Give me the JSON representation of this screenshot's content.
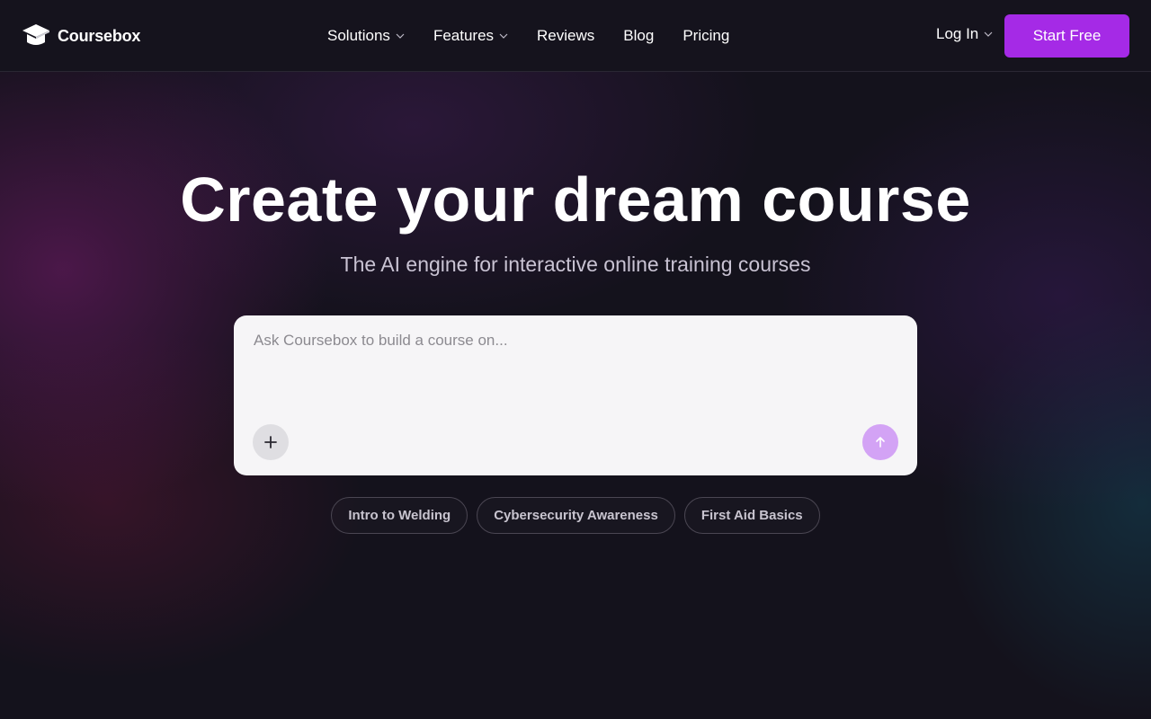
{
  "header": {
    "brand": "Coursebox",
    "nav": [
      {
        "label": "Solutions",
        "dropdown": true
      },
      {
        "label": "Features",
        "dropdown": true
      },
      {
        "label": "Reviews",
        "dropdown": false
      },
      {
        "label": "Blog",
        "dropdown": false
      },
      {
        "label": "Pricing",
        "dropdown": false
      }
    ],
    "login_label": "Log In",
    "cta_label": "Start Free"
  },
  "hero": {
    "title": "Create your dream course",
    "subtitle": "The AI engine for interactive online training courses"
  },
  "prompt": {
    "placeholder": "Ask Coursebox to build a course on...",
    "value": "",
    "attach_icon": "plus-icon",
    "send_icon": "arrow-up-icon"
  },
  "suggestions": [
    "Intro to Welding",
    "Cybersecurity Awareness",
    "First Aid Basics"
  ],
  "colors": {
    "accent": "#a52ae6",
    "send_button": "#d3a3f5",
    "background": "#14121c",
    "input_bg": "#f6f5f7"
  }
}
